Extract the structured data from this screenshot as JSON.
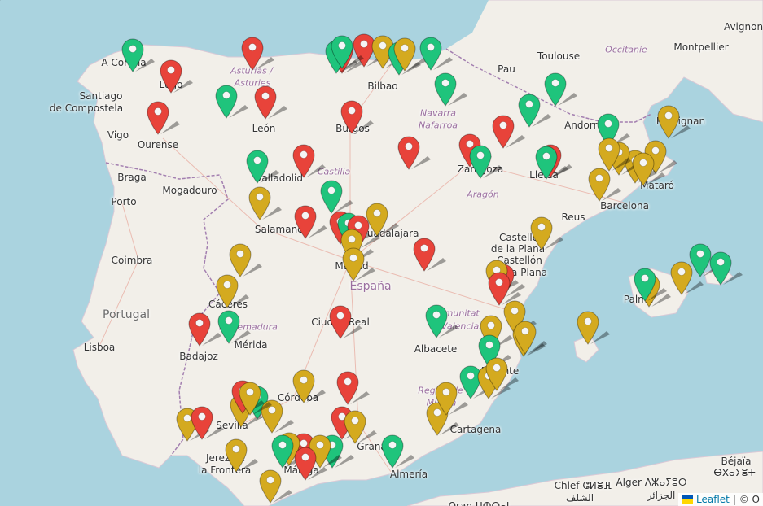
{
  "colors": {
    "sea": "#aad3df",
    "land": "#f2efe9",
    "green": "#1fc47c",
    "red": "#e8433a",
    "gold": "#d4aa1f"
  },
  "labels": [
    {
      "text": "A Coruña",
      "kind": "city"
    },
    {
      "text": "Lugo",
      "kind": "city"
    },
    {
      "text": "Santiago",
      "kind": "city"
    },
    {
      "text": "de Compostela",
      "kind": "city"
    },
    {
      "text": "Asturias /",
      "kind": "region"
    },
    {
      "text": "Asturies",
      "kind": "region"
    },
    {
      "text": "Ourense",
      "kind": "city"
    },
    {
      "text": "Vigo",
      "kind": "city"
    },
    {
      "text": "León",
      "kind": "city"
    },
    {
      "text": "Burgos",
      "kind": "city"
    },
    {
      "text": "Bilbao",
      "kind": "city"
    },
    {
      "text": "Navarra",
      "kind": "region"
    },
    {
      "text": "Nafarroa",
      "kind": "region"
    },
    {
      "text": "Pau",
      "kind": "city"
    },
    {
      "text": "Toulouse",
      "kind": "city"
    },
    {
      "text": "Occitanie",
      "kind": "region"
    },
    {
      "text": "Montpellier",
      "kind": "city"
    },
    {
      "text": "Avignon",
      "kind": "city"
    },
    {
      "text": "Perpignan",
      "kind": "city"
    },
    {
      "text": "Andorra",
      "kind": "city"
    },
    {
      "text": "Braga",
      "kind": "city"
    },
    {
      "text": "Porto",
      "kind": "city"
    },
    {
      "text": "Mogadouro",
      "kind": "city"
    },
    {
      "text": "Valladolid",
      "kind": "city"
    },
    {
      "text": "Castilla",
      "kind": "region"
    },
    {
      "text": "Zaragoza",
      "kind": "city"
    },
    {
      "text": "Aragón",
      "kind": "region"
    },
    {
      "text": "Lleida",
      "kind": "city"
    },
    {
      "text": "Mataró",
      "kind": "city"
    },
    {
      "text": "Barcelona",
      "kind": "city"
    },
    {
      "text": "Reus",
      "kind": "city"
    },
    {
      "text": "Salamanca",
      "kind": "city"
    },
    {
      "text": "Guadalajara",
      "kind": "city"
    },
    {
      "text": "Castelló",
      "kind": "city"
    },
    {
      "text": "de la Plana",
      "kind": "city"
    },
    {
      "text": "Castellón",
      "kind": "city"
    },
    {
      "text": "de la Plana",
      "kind": "city"
    },
    {
      "text": "Coimbra",
      "kind": "city"
    },
    {
      "text": "Madrid",
      "kind": "city"
    },
    {
      "text": "España",
      "kind": "country-main"
    },
    {
      "text": "Portugal",
      "kind": "country"
    },
    {
      "text": "Cáceres",
      "kind": "city"
    },
    {
      "text": "Palma",
      "kind": "city"
    },
    {
      "text": "Lisboa",
      "kind": "city"
    },
    {
      "text": "Extremadura",
      "kind": "region"
    },
    {
      "text": "Mérida",
      "kind": "city"
    },
    {
      "text": "Badajoz",
      "kind": "city"
    },
    {
      "text": "Ciudad Real",
      "kind": "city"
    },
    {
      "text": "Comunitat",
      "kind": "region"
    },
    {
      "text": "Valenciana",
      "kind": "region"
    },
    {
      "text": "Albacete",
      "kind": "city"
    },
    {
      "text": "Alicante",
      "kind": "city"
    },
    {
      "text": "Córdoba",
      "kind": "city"
    },
    {
      "text": "Región de",
      "kind": "region"
    },
    {
      "text": "Murcia",
      "kind": "region"
    },
    {
      "text": "Sevilla",
      "kind": "city"
    },
    {
      "text": "Cartagena",
      "kind": "city"
    },
    {
      "text": "Granada",
      "kind": "city"
    },
    {
      "text": "Jerez de",
      "kind": "city"
    },
    {
      "text": "la Frontera",
      "kind": "city"
    },
    {
      "text": "Almería",
      "kind": "city"
    },
    {
      "text": "Málaga",
      "kind": "city"
    },
    {
      "text": "Béjaïa",
      "kind": "city"
    },
    {
      "text": "ⴱⴳⴰⵢⴻⵜ",
      "kind": "city"
    },
    {
      "text": "Chlef ⵛⵍⴻⴼ",
      "kind": "city"
    },
    {
      "text": "الشلف",
      "kind": "city"
    },
    {
      "text": "Alger ⴷⵣⴰⵢⴻⵔ",
      "kind": "city"
    },
    {
      "text": "الجزائر",
      "kind": "city"
    },
    {
      "text": "Oran ⵡⵀⵔⴰⵏ",
      "kind": "city"
    }
  ],
  "markers": [
    {
      "color": "green",
      "place": "A Coruña"
    },
    {
      "color": "red",
      "place": "Lugo"
    },
    {
      "color": "green",
      "place": "Asturias"
    },
    {
      "color": "red",
      "place": "Asturias"
    },
    {
      "color": "red",
      "place": "Cantabria"
    },
    {
      "color": "green",
      "place": "Cantabria"
    },
    {
      "color": "red",
      "place": "Santander"
    },
    {
      "color": "gold",
      "place": "Santander"
    },
    {
      "color": "green",
      "place": "Bilbao"
    },
    {
      "color": "gold",
      "place": "Bilbao"
    },
    {
      "color": "green",
      "place": "San Sebastián"
    },
    {
      "color": "green",
      "place": "Navarra"
    },
    {
      "color": "green",
      "place": "Pau"
    },
    {
      "color": "green",
      "place": "Toulouse"
    },
    {
      "color": "red",
      "place": "Ourense"
    },
    {
      "color": "green",
      "place": "Asturias"
    },
    {
      "color": "red",
      "place": "León"
    },
    {
      "color": "red",
      "place": "Burgos"
    },
    {
      "color": "red",
      "place": "Logroño"
    },
    {
      "color": "red",
      "place": "Zaragoza"
    },
    {
      "color": "red",
      "place": "Huesca"
    },
    {
      "color": "green",
      "place": "Andorra"
    },
    {
      "color": "gold",
      "place": "Perpignan"
    },
    {
      "color": "green",
      "place": "Valladolid"
    },
    {
      "color": "red",
      "place": "Palencia"
    },
    {
      "color": "green",
      "place": "Zaragoza"
    },
    {
      "color": "red",
      "place": "Lleida"
    },
    {
      "color": "green",
      "place": "Lleida"
    },
    {
      "color": "gold",
      "place": "Girona"
    },
    {
      "color": "gold",
      "place": "Barcelona"
    },
    {
      "color": "gold",
      "place": "Barcelona"
    },
    {
      "color": "gold",
      "place": "Barcelona"
    },
    {
      "color": "gold",
      "place": "Barcelona"
    },
    {
      "color": "gold",
      "place": "Girona"
    },
    {
      "color": "gold",
      "place": "Salamanca"
    },
    {
      "color": "green",
      "place": "Segovia"
    },
    {
      "color": "red",
      "place": "Ávila"
    },
    {
      "color": "red",
      "place": "Madrid"
    },
    {
      "color": "green",
      "place": "Madrid"
    },
    {
      "color": "red",
      "place": "Madrid"
    },
    {
      "color": "gold",
      "place": "Madrid"
    },
    {
      "color": "gold",
      "place": "Guadalajara"
    },
    {
      "color": "red",
      "place": "Cuenca"
    },
    {
      "color": "gold",
      "place": "Tarragona"
    },
    {
      "color": "gold",
      "place": "Madrid"
    },
    {
      "color": "gold",
      "place": "Cáceres"
    },
    {
      "color": "gold",
      "place": "Cáceres"
    },
    {
      "color": "red",
      "place": "Valencia"
    },
    {
      "color": "gold",
      "place": "Valencia"
    },
    {
      "color": "red",
      "place": "Valencia"
    },
    {
      "color": "gold",
      "place": "Valencia"
    },
    {
      "color": "gold",
      "place": "Palma"
    },
    {
      "color": "green",
      "place": "Palma"
    },
    {
      "color": "gold",
      "place": "Mallorca"
    },
    {
      "color": "green",
      "place": "Menorca"
    },
    {
      "color": "green",
      "place": "Menorca"
    },
    {
      "color": "red",
      "place": "Badajoz"
    },
    {
      "color": "green",
      "place": "Mérida"
    },
    {
      "color": "red",
      "place": "Ciudad Real"
    },
    {
      "color": "green",
      "place": "Albacete"
    },
    {
      "color": "gold",
      "place": "Valencia"
    },
    {
      "color": "gold",
      "place": "Ibiza"
    },
    {
      "color": "gold",
      "place": "Gandia"
    },
    {
      "color": "gold",
      "place": "Denia"
    },
    {
      "color": "green",
      "place": "Alicante"
    },
    {
      "color": "green",
      "place": "Elche"
    },
    {
      "color": "gold",
      "place": "Alicante"
    },
    {
      "color": "gold",
      "place": "Benidorm"
    },
    {
      "color": "gold",
      "place": "Córdoba"
    },
    {
      "color": "red",
      "place": "Jaén"
    },
    {
      "color": "gold",
      "place": "Murcia"
    },
    {
      "color": "gold",
      "place": "Murcia"
    },
    {
      "color": "gold",
      "place": "Huelva"
    },
    {
      "color": "red",
      "place": "Huelva"
    },
    {
      "color": "gold",
      "place": "Sevilla"
    },
    {
      "color": "green",
      "place": "Sevilla"
    },
    {
      "color": "gold",
      "place": "Sevilla"
    },
    {
      "color": "red",
      "place": "Sevilla"
    },
    {
      "color": "gold",
      "place": "Osuna"
    },
    {
      "color": "red",
      "place": "Granada"
    },
    {
      "color": "gold",
      "place": "Granada"
    },
    {
      "color": "green",
      "place": "Almería"
    },
    {
      "color": "gold",
      "place": "Jerez de la Frontera"
    },
    {
      "color": "red",
      "place": "Málaga"
    },
    {
      "color": "green",
      "place": "Málaga"
    },
    {
      "color": "gold",
      "place": "Málaga"
    },
    {
      "color": "green",
      "place": "Málaga"
    },
    {
      "color": "gold",
      "place": "Marbella"
    },
    {
      "color": "gold",
      "place": "Cádiz"
    },
    {
      "color": "red",
      "place": "Málaga"
    },
    {
      "color": "green",
      "place": "Motril"
    }
  ],
  "attribution": {
    "link": "Leaflet",
    "rest": "| © O"
  }
}
